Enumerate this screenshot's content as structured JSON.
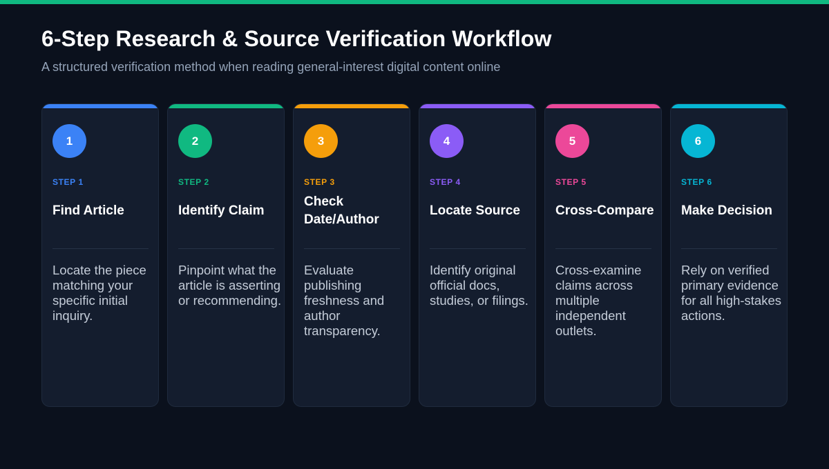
{
  "header": {
    "title": "6-Step Research & Source Verification Workflow",
    "subtitle": "A structured verification method when reading general-interest digital content online"
  },
  "colors": {
    "background": "#0b111d",
    "top_bar": "#10b981",
    "card": "#141d2e"
  },
  "steps": [
    {
      "number": "1",
      "label": "STEP 1",
      "title": "Find Article",
      "description": "Locate the piece matching your specific initial inquiry.",
      "color": "#3b82f6"
    },
    {
      "number": "2",
      "label": "STEP 2",
      "title": "Identify Claim",
      "description": "Pinpoint what the article is asserting or recommending.",
      "color": "#10b981"
    },
    {
      "number": "3",
      "label": "STEP 3",
      "title": "Check Date/Author",
      "description": "Evaluate publishing freshness and author transparency.",
      "color": "#f59e0b"
    },
    {
      "number": "4",
      "label": "STEP 4",
      "title": "Locate Source",
      "description": "Identify original official docs, studies, or filings.",
      "color": "#8b5cf6"
    },
    {
      "number": "5",
      "label": "STEP 5",
      "title": "Cross-Compare",
      "description": "Cross-examine claims across multiple independent outlets.",
      "color": "#ec4899"
    },
    {
      "number": "6",
      "label": "STEP 6",
      "title": "Make Decision",
      "description": "Rely on verified primary evidence for all high-stakes actions.",
      "color": "#06b6d4"
    }
  ]
}
